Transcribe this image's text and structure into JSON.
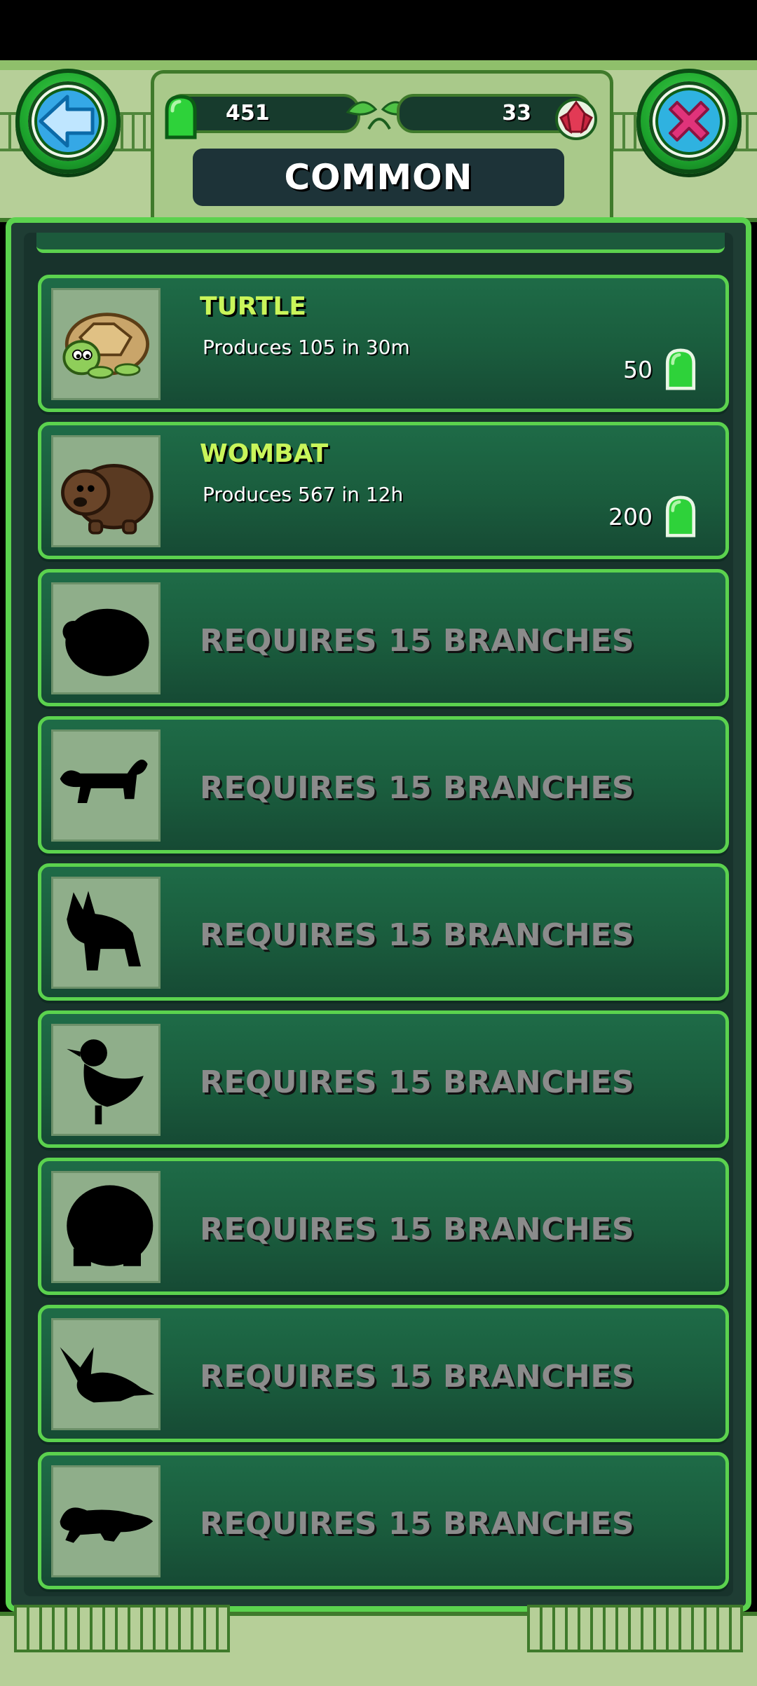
{
  "header": {
    "title": "COMMON",
    "gems": "451",
    "rubies": "33"
  },
  "items": [
    {
      "name": "TURTLE",
      "description": "Produces 105 in 30m",
      "price": "50",
      "locked": false,
      "icon": "turtle-icon"
    },
    {
      "name": "WOMBAT",
      "description": "Produces 567 in 12h",
      "price": "200",
      "locked": false,
      "icon": "wombat-icon"
    },
    {
      "label": "REQUIRES 15 BRANCHES",
      "locked": true,
      "icon": "locked-silhouette-icon"
    },
    {
      "label": "REQUIRES 15 BRANCHES",
      "locked": true,
      "icon": "locked-silhouette-icon"
    },
    {
      "label": "REQUIRES 15 BRANCHES",
      "locked": true,
      "icon": "locked-silhouette-icon"
    },
    {
      "label": "REQUIRES 15 BRANCHES",
      "locked": true,
      "icon": "locked-silhouette-icon"
    },
    {
      "label": "REQUIRES 15 BRANCHES",
      "locked": true,
      "icon": "locked-silhouette-icon"
    },
    {
      "label": "REQUIRES 15 BRANCHES",
      "locked": true,
      "icon": "locked-silhouette-icon"
    },
    {
      "label": "REQUIRES 15 BRANCHES",
      "locked": true,
      "icon": "locked-silhouette-icon"
    }
  ],
  "colors": {
    "accent_green": "#5bd24e",
    "name_yellow": "#c9f55a",
    "locked_gray": "#8b8b8b"
  }
}
